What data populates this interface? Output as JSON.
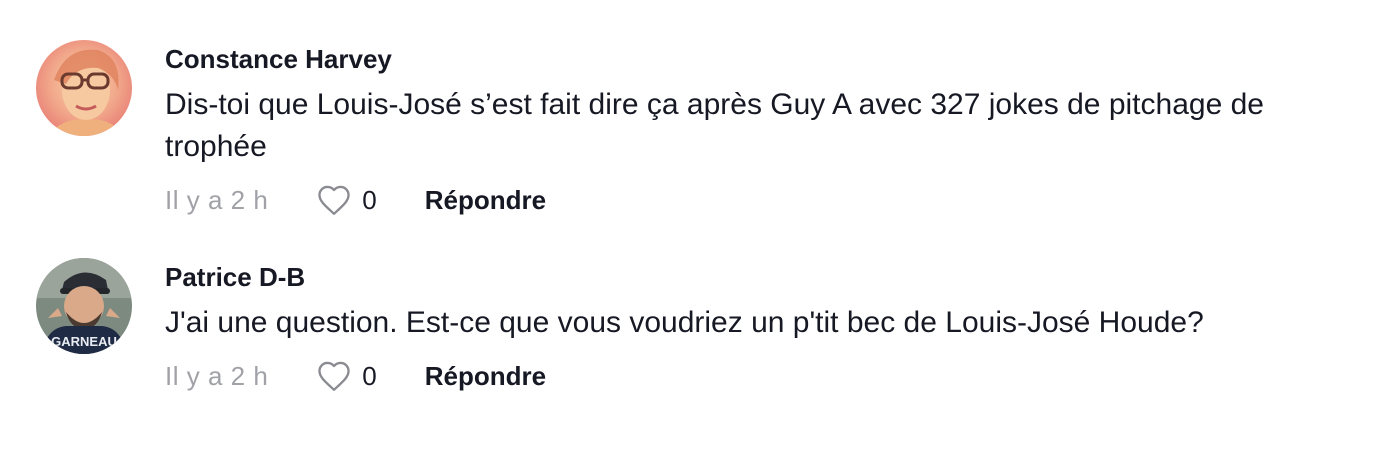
{
  "comments": [
    {
      "username": "Constance Harvey",
      "text": "Dis-toi que Louis-José s’est fait dire ça après Guy A avec 327 jokes de pitchage de trophée",
      "time": "Il y a 2 h",
      "likes": "0",
      "reply_label": "Répondre",
      "avatar_icon": "user-avatar-photo"
    },
    {
      "username": "Patrice D-B",
      "text": "J'ai une question. Est-ce que vous voudriez un p'tit bec de Louis-José Houde?",
      "time": "Il y a 2 h",
      "likes": "0",
      "reply_label": "Répondre",
      "avatar_icon": "user-avatar-photo",
      "avatar_text": "GARNEAU"
    }
  ],
  "icons": {
    "like": "heart-outline-icon"
  },
  "colors": {
    "text_primary": "#161823",
    "text_secondary": "#a1a2a7",
    "background": "#ffffff"
  }
}
